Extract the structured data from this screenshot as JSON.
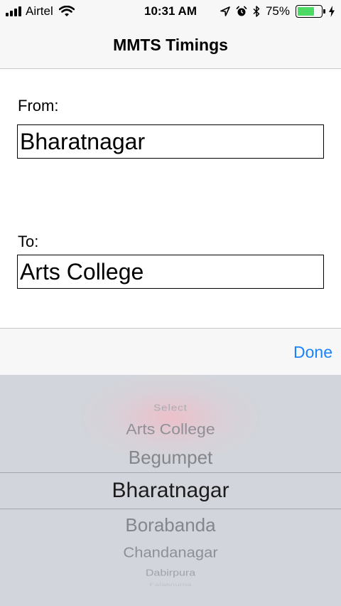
{
  "status_bar": {
    "carrier": "Airtel",
    "time": "10:31 AM",
    "battery_percent": "75%",
    "battery_level": 0.75,
    "icons": [
      "signal-bars-icon",
      "wifi-icon",
      "location-arrow-icon",
      "alarm-icon",
      "bluetooth-icon",
      "battery-icon",
      "charging-bolt-icon"
    ]
  },
  "nav": {
    "title": "MMTS Timings"
  },
  "form": {
    "from_label": "From:",
    "from_value": "Bharatnagar",
    "to_label": "To:",
    "to_value": "Arts College"
  },
  "toolbar": {
    "done_label": "Done"
  },
  "picker": {
    "items": [
      "Select",
      "Arts College",
      "Begumpet",
      "Bharatnagar",
      "Borabanda",
      "Chandanagar",
      "Dabirpura",
      "Falaknuma"
    ],
    "selected": "Bharatnagar"
  },
  "colors": {
    "accent": "#1a82fb",
    "picker_bg": "#d2d5db",
    "battery": "#4cd964"
  }
}
